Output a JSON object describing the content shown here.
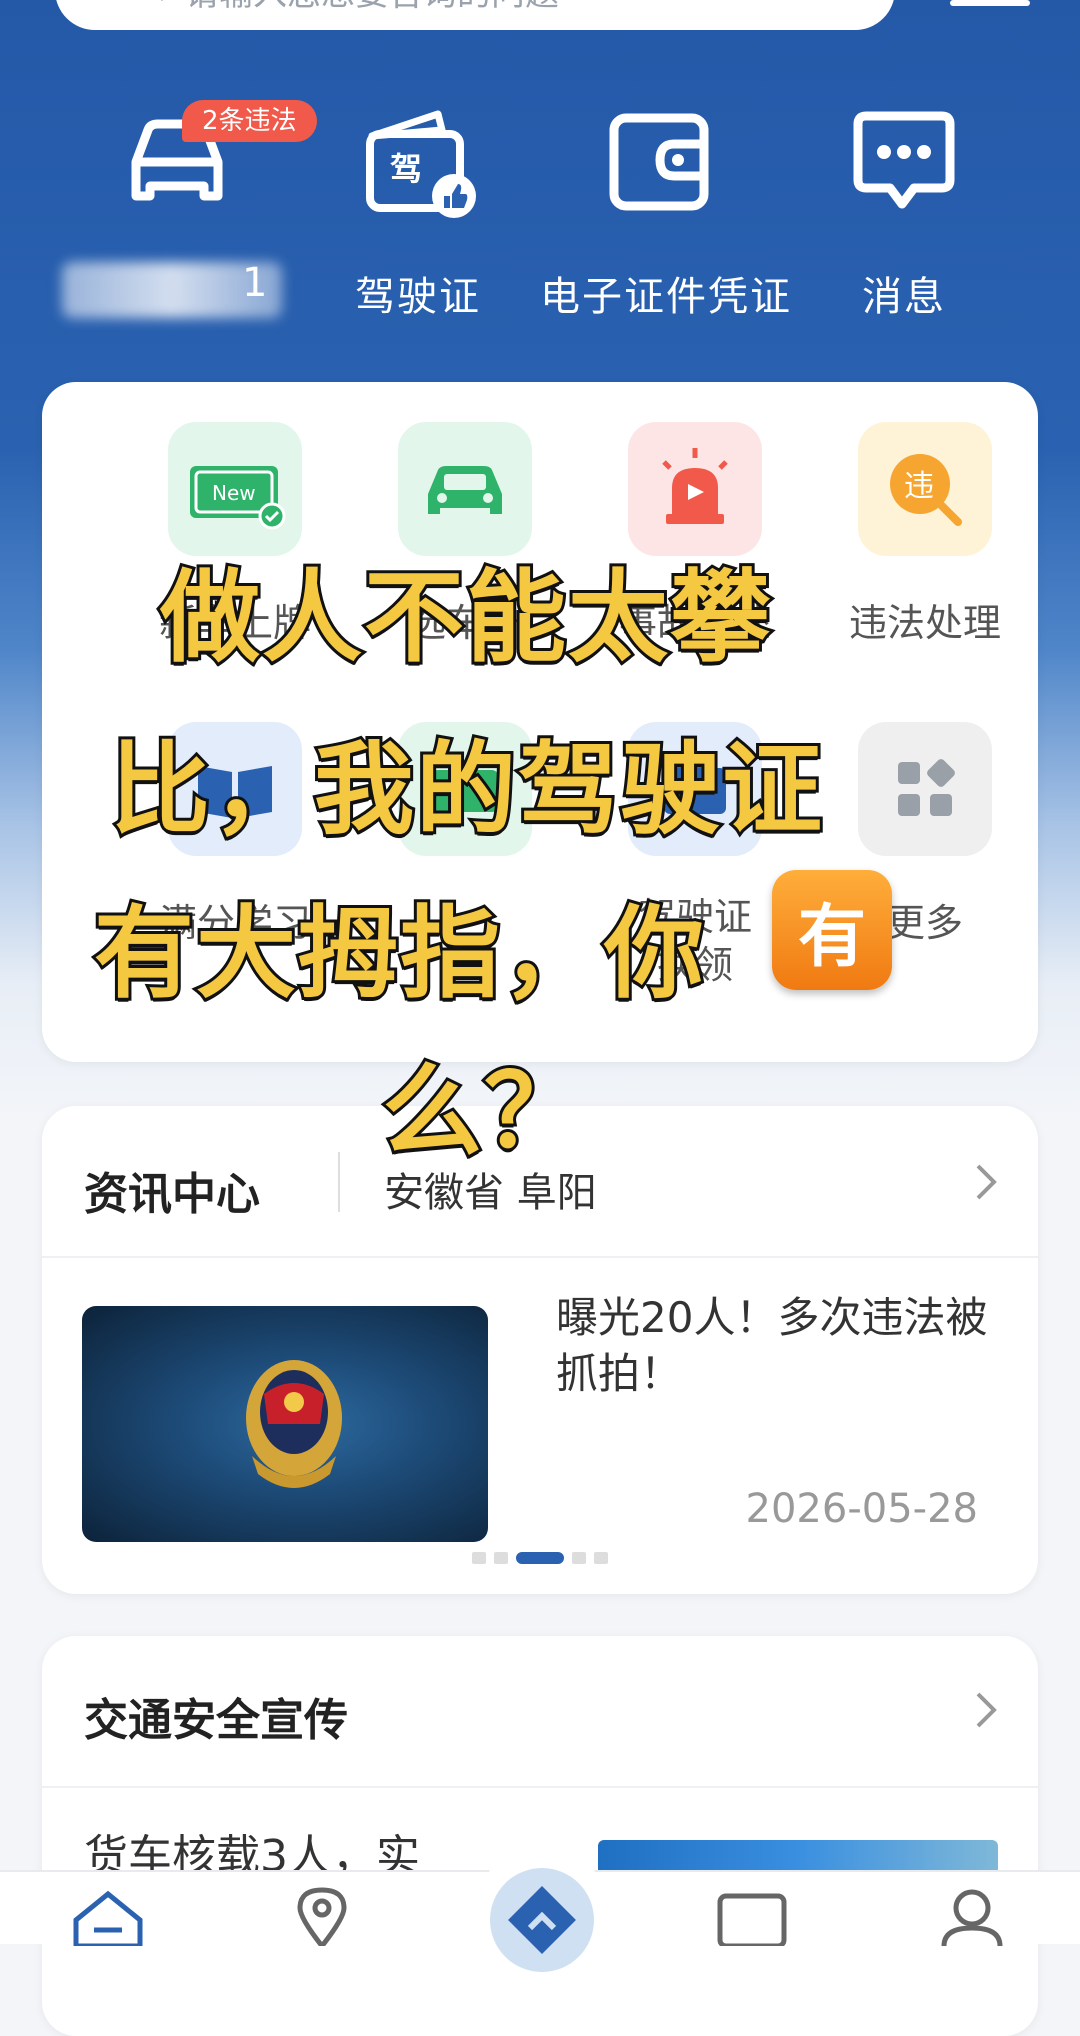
{
  "search": {
    "placeholder": "请输入您想要咨询的问题"
  },
  "quick": {
    "violation_badge": "2条违法",
    "plate_suffix": "1",
    "items": [
      {
        "label": "驾驶证"
      },
      {
        "label": "电子证件凭证"
      },
      {
        "label": "消息"
      }
    ]
  },
  "services": {
    "row1": [
      {
        "label": "新车上牌"
      },
      {
        "label": "选车号"
      },
      {
        "label": "事故快处"
      },
      {
        "label": "违法处理"
      }
    ],
    "row2": [
      {
        "label": "满分学习"
      },
      {
        "label": ""
      },
      {
        "label_line1": "驾驶证",
        "label_line2": "换领"
      },
      {
        "label": "更多"
      }
    ]
  },
  "caption": {
    "line1": "做人不能太攀",
    "line2": "比，我的驾驶证",
    "line3": "有大拇指，你",
    "line4": "么？",
    "badge": "有"
  },
  "news": {
    "title": "资讯中心",
    "region": "安徽省 阜阳",
    "headline": "曝光20人！多次违法被抓拍！",
    "date": "2026-05-28"
  },
  "safety": {
    "title": "交通安全宣传",
    "item": "货车核载3人，实"
  },
  "colors": {
    "primary_blue": "#2a62b1",
    "badge_red": "#f15a4a",
    "caption_yellow": "#f5c842"
  }
}
